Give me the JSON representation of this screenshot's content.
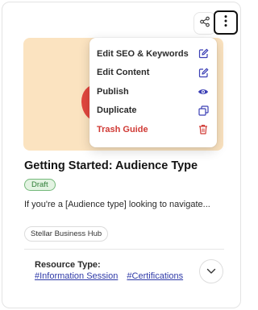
{
  "card": {
    "title": "Getting Started: Audience Type",
    "status": "Draft",
    "description": "If you're a [Audience type] looking to navigate...",
    "hub": "Stellar Business Hub",
    "resource_label": "Resource Type:",
    "tags": [
      "#Information Session",
      "#Certifications"
    ]
  },
  "actions": {
    "share_icon": "share-icon",
    "more_icon": "more-vertical-icon",
    "expand_icon": "chevron-down-icon"
  },
  "menu": {
    "items": [
      {
        "label": "Edit SEO & Keywords",
        "icon": "edit-icon"
      },
      {
        "label": "Edit Content",
        "icon": "edit-icon"
      },
      {
        "label": "Publish",
        "icon": "eye-icon"
      },
      {
        "label": "Duplicate",
        "icon": "duplicate-icon"
      },
      {
        "label": "Trash Guide",
        "icon": "trash-icon"
      }
    ]
  },
  "colors": {
    "accent": "#3b3fb5",
    "danger": "#d03a35",
    "thumbnail_bg": "#fbe3c0",
    "draft_badge": "#e3f3e2"
  }
}
